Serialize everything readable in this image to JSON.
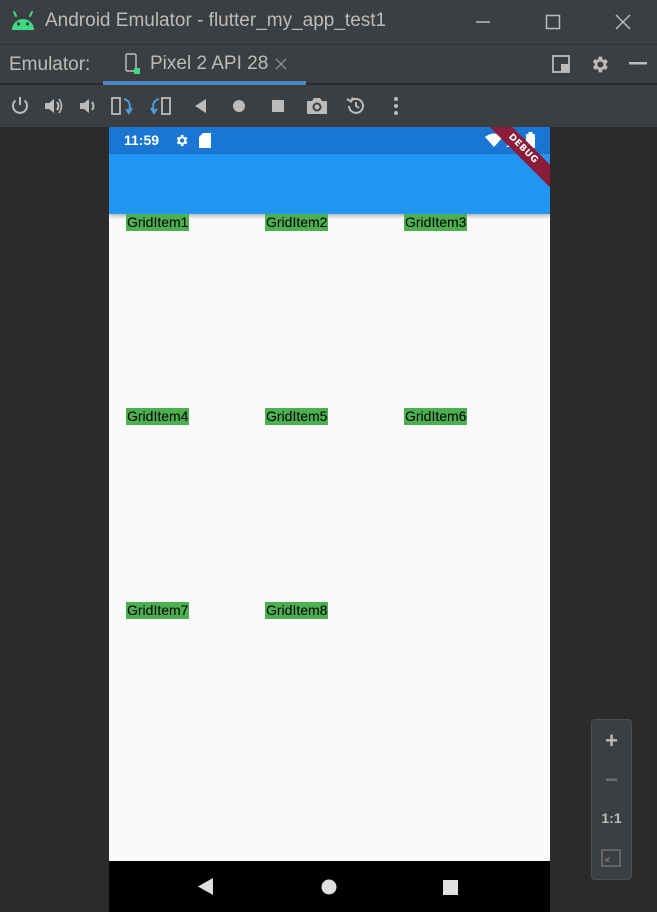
{
  "window": {
    "title": "Android Emulator - flutter_my_app_test1",
    "icon": "android-logo-icon",
    "controls": [
      "minimize-icon",
      "maximize-icon",
      "close-icon"
    ]
  },
  "tabbar": {
    "label": "Emulator:",
    "active_tab": "Pixel 2 API 28",
    "icons": [
      "device-phone-icon",
      "tab-close-icon",
      "dock-layout-icon",
      "settings-gear-icon",
      "hide-panel-icon"
    ],
    "accent": "#4a88c7"
  },
  "toolbar": {
    "icons": [
      "power-icon",
      "volume-up-icon",
      "volume-down-icon",
      "rotate-left-icon",
      "rotate-right-icon",
      "back-icon",
      "home-icon",
      "overview-icon",
      "screenshot-icon",
      "snapshot-icon",
      "more-vert-icon"
    ]
  },
  "device": {
    "status_time": "11:59",
    "status_icons": [
      "settings-icon",
      "sd-card-icon",
      "wifi-icon",
      "signal-icon",
      "battery-icon"
    ],
    "debug_banner": "DEBUG",
    "appbar_color": "#2196f3",
    "statusbar_color": "#1976d2",
    "grid_items": [
      "GridItem1",
      "GridItem2",
      "GridItem3",
      "GridItem4",
      "GridItem5",
      "GridItem6",
      "GridItem7",
      "GridItem8"
    ],
    "grid_item_color": "#4caf50",
    "navbar_buttons": [
      "nav-back-icon",
      "nav-home-icon",
      "nav-recents-icon"
    ]
  },
  "zoom_panel": {
    "zoom_in": "+",
    "zoom_out": "−",
    "one_to_one": "1:1",
    "fit_icon": "fit-screen-icon"
  }
}
